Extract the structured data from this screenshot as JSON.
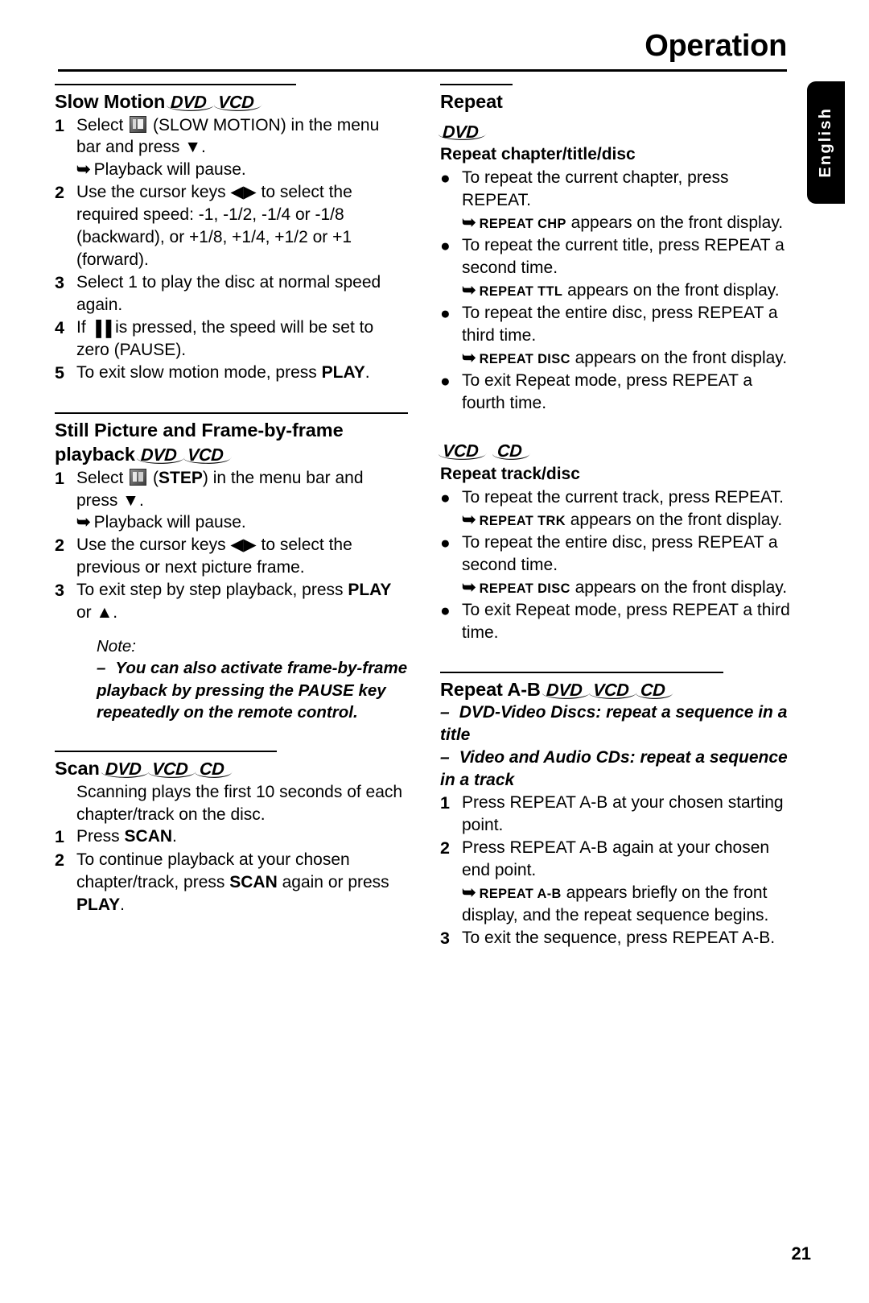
{
  "header": {
    "title": "Operation"
  },
  "language_tab": {
    "label": "English"
  },
  "footer": {
    "page_number": "21"
  },
  "logos": {
    "dvd": "DVD",
    "vcd": "VCD",
    "cd": "CD"
  },
  "left_column": {
    "slow_motion": {
      "title": "Slow Motion",
      "discs": [
        "DVD",
        "VCD"
      ],
      "steps": [
        {
          "num": "1",
          "text_before_icon": "Select ",
          "icon": "slow-motion-menu-icon",
          "text_after_icon": " (SLOW MOTION) in the menu bar and press ▼.",
          "result": "Playback will pause."
        },
        {
          "num": "2",
          "text": "Use the cursor keys ◀▶ to select the required speed: -1, -1/2, -1/4 or -1/8 (backward), or +1/8, +1/4, +1/2 or +1 (forward)."
        },
        {
          "num": "3",
          "text": "Select 1 to play the disc at normal speed again."
        },
        {
          "num": "4",
          "text_a": "If ",
          "pause_glyph": "▐▐",
          "text_b": " is pressed, the speed will be set to zero (PAUSE)."
        },
        {
          "num": "5",
          "text_a": "To exit slow motion mode, press ",
          "bold": "PLAY",
          "text_b": "."
        }
      ]
    },
    "still_picture": {
      "title_line1": "Still Picture and Frame-by-frame",
      "title_line2": "playback",
      "discs": [
        "DVD",
        "VCD"
      ],
      "steps": [
        {
          "num": "1",
          "text_before_icon": "Select ",
          "icon": "step-menu-icon",
          "text_after_icon_a": " (",
          "bold": "STEP",
          "text_after_icon_b": ") in the menu bar and press ▼.",
          "result": "Playback will pause."
        },
        {
          "num": "2",
          "text": "Use the cursor keys ◀▶ to select the previous or next picture frame."
        },
        {
          "num": "3",
          "text_a": "To exit step by step playback, press ",
          "bold": "PLAY",
          "text_b": " or ▲."
        }
      ],
      "note": {
        "heading": "Note:",
        "dash": "–",
        "text": "You can also activate frame-by-frame playback by pressing the PAUSE key repeatedly on the remote control."
      }
    },
    "scan": {
      "title": "Scan",
      "discs": [
        "DVD",
        "VCD",
        "CD"
      ],
      "intro": "Scanning plays the first 10 seconds of each chapter/track on the disc.",
      "steps": [
        {
          "num": "1",
          "text_a": "Press ",
          "bold": "SCAN",
          "text_b": "."
        },
        {
          "num": "2",
          "text_a": "To continue playback at your chosen chapter/track, press ",
          "bold1": "SCAN",
          "text_b": " again or press ",
          "bold2": "PLAY",
          "text_c": "."
        }
      ]
    }
  },
  "right_column": {
    "repeat": {
      "title": "Repeat",
      "dvd_group": {
        "disc": "DVD",
        "subtitle": "Repeat chapter/title/disc",
        "items": [
          {
            "text": "To repeat the current chapter, press REPEAT.",
            "result_caps": "REPEAT CHP",
            "result_rest": " appears on the front display."
          },
          {
            "text": "To repeat the current title, press REPEAT a second time.",
            "result_caps": "REPEAT TTL",
            "result_rest": " appears on the front display."
          },
          {
            "text": "To repeat the entire disc, press REPEAT a third time.",
            "result_caps": "REPEAT DISC",
            "result_rest": " appears on the front display."
          },
          {
            "text": "To exit Repeat mode, press REPEAT a fourth time."
          }
        ]
      },
      "vcd_cd_group": {
        "discs": [
          "VCD",
          "CD"
        ],
        "subtitle": "Repeat track/disc",
        "items": [
          {
            "text": "To repeat the current track, press REPEAT.",
            "result_caps": "REPEAT TRK",
            "result_rest": " appears on the front display."
          },
          {
            "text": "To repeat the entire disc, press REPEAT a second time.",
            "result_caps": "REPEAT DISC",
            "result_rest": " appears on the front display."
          },
          {
            "text": "To exit Repeat mode, press REPEAT a third time."
          }
        ]
      }
    },
    "repeat_ab": {
      "title": "Repeat A-B",
      "discs": [
        "DVD",
        "VCD",
        "CD"
      ],
      "bullets": [
        {
          "dash": "–",
          "text": "DVD-Video Discs: repeat a sequence in a title"
        },
        {
          "dash": "–",
          "text": "Video and Audio CDs: repeat a sequence in a track"
        }
      ],
      "steps": [
        {
          "num": "1",
          "text": "Press REPEAT A-B at your chosen starting point."
        },
        {
          "num": "2",
          "text": "Press REPEAT A-B again at your chosen end point.",
          "result_caps": "REPEAT A-B",
          "result_rest": " appears briefly on the front display, and the repeat sequence begins."
        },
        {
          "num": "3",
          "text": "To exit the sequence, press REPEAT A-B."
        }
      ]
    }
  }
}
